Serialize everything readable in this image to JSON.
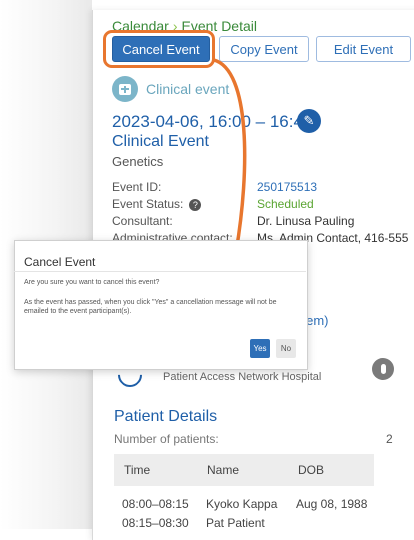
{
  "breadcrumb": {
    "parent": "Calendar",
    "separator": "›",
    "current": "Event Detail"
  },
  "toolbar": {
    "cancel_label": "Cancel Event",
    "copy_label": "Copy Event",
    "edit_label": "Edit Event"
  },
  "event": {
    "type_label": "Clinical event",
    "datetime": "2023-04-06, 16:00 – 16:45",
    "title": "Clinical Event",
    "department": "Genetics",
    "fields": {
      "id_label": "Event ID:",
      "id_value": "250175513",
      "status_label": "Event Status:",
      "status_value": "Scheduled",
      "consultant_label": "Consultant:",
      "consultant_value": "Dr. Linusa Pauling",
      "admin_label": "Administrative contact:",
      "admin_value": "Ms. Admin Contact, 416-555"
    },
    "system_text": "stem)",
    "hospital": "Patient Access Network Hospital"
  },
  "patients": {
    "section_title": "Patient Details",
    "count_label": "Number of patients:",
    "count_value": "2",
    "columns": [
      "Time",
      "Name",
      "DOB"
    ],
    "rows": [
      {
        "time": "08:00–08:15",
        "name": "Kyoko Kappa",
        "dob": "Aug 08, 1988"
      },
      {
        "time": "08:15–08:30",
        "name": "Pat Patient",
        "dob": ""
      }
    ]
  },
  "modal": {
    "title": "Cancel Event",
    "question": "Are you sure you want to cancel this event?",
    "note": "As the event has passed, when you click \"Yes\" a cancellation message will not be emailed to the event participant(s).",
    "yes_label": "Yes",
    "no_label": "No"
  },
  "colors": {
    "primary": "#2e6fb7",
    "highlight": "#e8762e",
    "status_green": "#5aa532",
    "breadcrumb_green": "#3a8a3a"
  },
  "icons": {
    "calendar": "calendar-plus-icon",
    "pencil": "pencil-icon",
    "help": "help-icon",
    "location": "location-pin-icon"
  }
}
